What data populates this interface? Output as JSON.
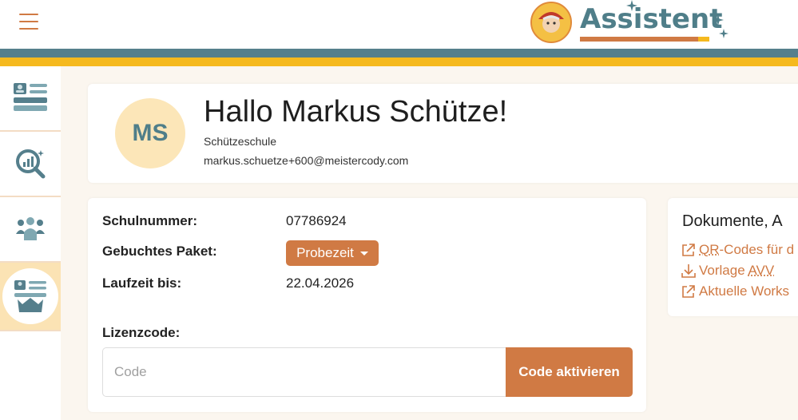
{
  "header": {
    "menu_icon": "hamburger-icon",
    "logo_text": "Assistent",
    "colors": {
      "accent": "#d07a44",
      "teal": "#557f8c",
      "yellow": "#f5b91e"
    }
  },
  "sidebar": {
    "items": [
      {
        "icon": "id-card-list-icon",
        "active": false
      },
      {
        "icon": "magnifier-chart-icon",
        "active": false
      },
      {
        "icon": "users-group-icon",
        "active": false
      },
      {
        "icon": "crown-list-icon",
        "active": true
      }
    ]
  },
  "profile": {
    "initials": "MS",
    "greeting": "Hallo Markus Schütze!",
    "school": "Schützeschule",
    "email": "markus.schuetze+600@meistercody.com"
  },
  "details": {
    "school_number_label": "Schulnummer:",
    "school_number_value": "07786924",
    "package_label": "Gebuchtes Paket:",
    "package_value": "Probezeit",
    "runtime_label": "Laufzeit bis:",
    "runtime_value": "22.04.2026",
    "license_label": "Lizenzcode:",
    "license_placeholder": "Code",
    "activate_button": "Code aktivieren"
  },
  "documents": {
    "title": "Dokumente, A",
    "links": [
      {
        "text_first": "QR",
        "text_rest": "-Codes für d",
        "icon": "external-link-icon"
      },
      {
        "text_first": "Vorlage ",
        "text_rest": "AVV",
        "icon": "download-icon"
      },
      {
        "text_first": "Aktuelle Works",
        "text_rest": "",
        "icon": "external-link-icon"
      }
    ]
  }
}
